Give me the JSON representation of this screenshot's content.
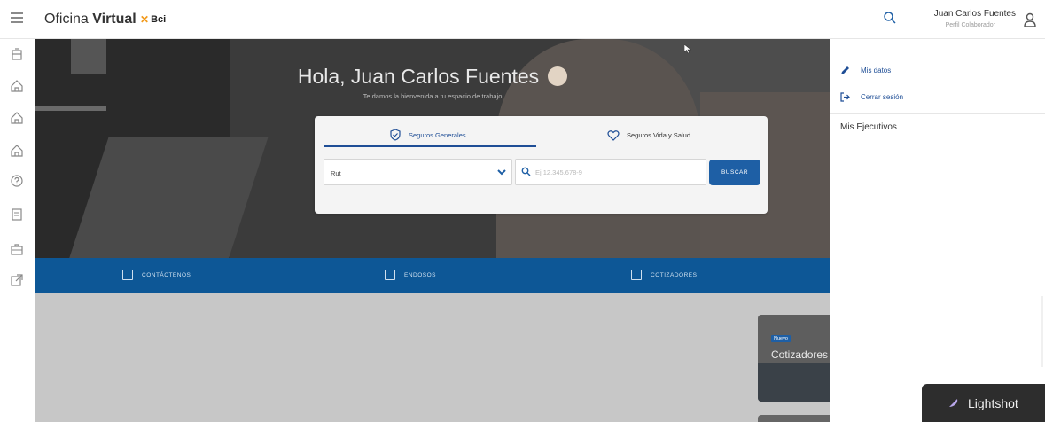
{
  "header": {
    "brand_light": "Oficina",
    "brand_bold": "Virtual",
    "logo_text": "Bci",
    "user_name": "Juan Carlos Fuentes",
    "user_role": "Perfil Colaborador"
  },
  "rail": {
    "icons": [
      "building-icon",
      "home-icon",
      "home-icon",
      "home-icon",
      "help-icon",
      "document-icon",
      "briefcase-icon",
      "external-link-icon"
    ]
  },
  "hero": {
    "greeting": "Hola, Juan Carlos Fuentes",
    "subgreeting": "Te damos la bienvenida a tu espacio de trabajo"
  },
  "search_card": {
    "tab_general": "Seguros Generales",
    "tab_life": "Seguros Vida y Salud",
    "select_value": "Rut",
    "input_placeholder": "Ej 12.345.678-9",
    "button_label": "BUSCAR"
  },
  "bluebar": {
    "contact": "CONTÁCTENOS",
    "endorsements": "ENDOSOS",
    "quoters": "COTIZADORES"
  },
  "promo": {
    "badge": "Nuevo",
    "title": "Cotizadores"
  },
  "right_panel": {
    "my_data": "Mis datos",
    "logout": "Cerrar sesión",
    "executives_title": "Mis Ejecutivos"
  },
  "lightshot": {
    "label": "Lightshot"
  },
  "colors": {
    "primary_blue": "#0d5796",
    "button_blue": "#1e5fa5",
    "link_blue": "#1f4e96",
    "bci_orange": "#f29a1c"
  }
}
